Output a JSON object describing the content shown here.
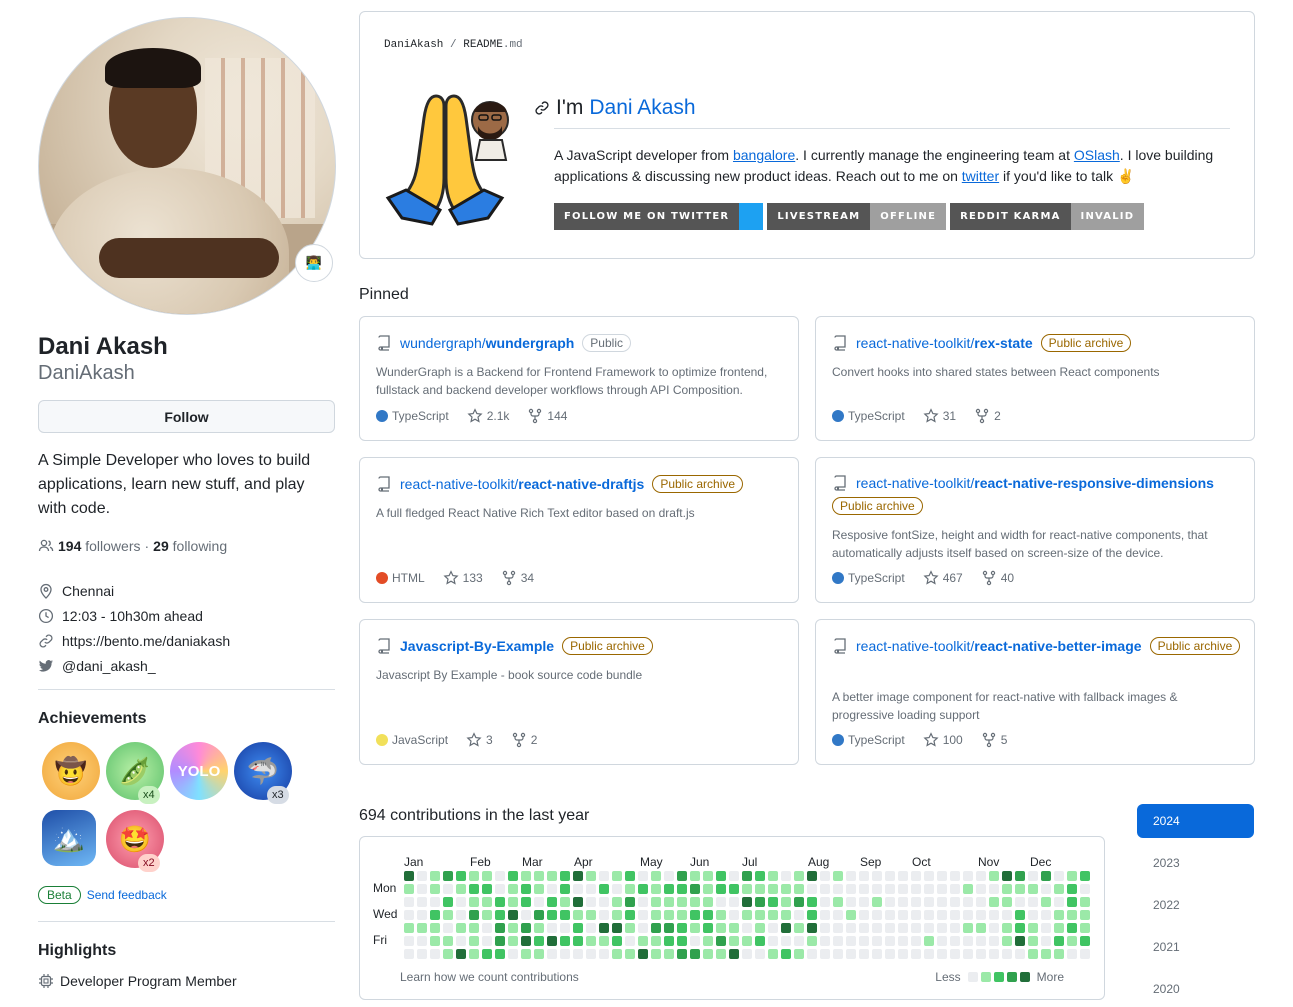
{
  "profile": {
    "name": "Dani Akash",
    "username": "DaniAkash",
    "status_emoji": "👨‍💻",
    "follow_label": "Follow",
    "bio": "A Simple Developer who loves to build applications, learn new stuff, and play with code.",
    "followers_count": "194",
    "followers_label": "followers",
    "dot": "·",
    "following_count": "29",
    "following_label": "following",
    "location": "Chennai",
    "local_time": "12:03 - 10h30m ahead",
    "website": "https://bento.me/daniakash",
    "twitter": "@dani_akash_"
  },
  "achievements": {
    "title": "Achievements",
    "badges": [
      {
        "name": "cowboy-badge",
        "emoji": "🤠",
        "count": ""
      },
      {
        "name": "pair-extraordinaire-badge",
        "emoji": "🫛",
        "count": "x4"
      },
      {
        "name": "yolo-badge",
        "emoji": "YOLO",
        "count": ""
      },
      {
        "name": "pull-shark-badge",
        "emoji": "🦈",
        "count": "x3"
      },
      {
        "name": "arctic-code-vault-badge",
        "emoji": "🏔️",
        "count": ""
      },
      {
        "name": "starstruck-badge",
        "emoji": "🤩",
        "count": "x2"
      }
    ],
    "beta_label": "Beta",
    "feedback_label": "Send feedback"
  },
  "highlights": {
    "title": "Highlights",
    "item": "Developer Program Member"
  },
  "readme": {
    "owner": "DaniAkash",
    "slash": "/",
    "file": "README",
    "ext": ".md",
    "heading_prefix": "I'm",
    "heading_name": "Dani Akash",
    "para_1": "A JavaScript developer from",
    "link_bangalore": "bangalore",
    "para_2": ". I currently manage the engineering team at",
    "link_oslash": "OSlash",
    "para_3": ". I love building applications & discussing new product ideas. Reach out to me on",
    "link_twitter": "twitter",
    "para_4": "if you'd like to talk ✌️",
    "shields": [
      {
        "label": "FOLLOW ME ON TWITTER",
        "value": "",
        "color": "#1DA1F2"
      },
      {
        "label": "LIVESTREAM",
        "value": "OFFLINE",
        "color": "#9f9f9f"
      },
      {
        "label": "REDDIT KARMA",
        "value": "INVALID",
        "color": "#9f9f9f"
      }
    ]
  },
  "pinned": {
    "title": "Pinned",
    "repos": [
      {
        "owner": "wundergraph/",
        "name": "wundergraph",
        "visibility": "Public",
        "archive": false,
        "description": "WunderGraph is a Backend for Frontend Framework to optimize frontend, fullstack and backend developer workflows through API Composition.",
        "language": "TypeScript",
        "lang_color": "#3178c6",
        "stars": "2.1k",
        "forks": "144"
      },
      {
        "owner": "react-native-toolkit/",
        "name": "rex-state",
        "visibility": "Public archive",
        "archive": true,
        "description": "Convert hooks into shared states between React components",
        "language": "TypeScript",
        "lang_color": "#3178c6",
        "stars": "31",
        "forks": "2"
      },
      {
        "owner": "react-native-toolkit/",
        "name": "react-native-draftjs",
        "visibility": "Public archive",
        "archive": true,
        "description": "A full fledged React Native Rich Text editor based on draft.js",
        "language": "HTML",
        "lang_color": "#e34c26",
        "stars": "133",
        "forks": "34"
      },
      {
        "owner": "react-native-toolkit/",
        "name": "react-native-responsive-dimensions",
        "visibility": "Public archive",
        "archive": true,
        "description": "Resposive fontSize, height and width for react-native components, that automatically adjusts itself based on screen-size of the device.",
        "language": "TypeScript",
        "lang_color": "#3178c6",
        "stars": "467",
        "forks": "40"
      },
      {
        "owner": "",
        "name": "Javascript-By-Example",
        "visibility": "Public archive",
        "archive": true,
        "description": "Javascript By Example - book source code bundle",
        "language": "JavaScript",
        "lang_color": "#f1e05a",
        "stars": "3",
        "forks": "2"
      },
      {
        "owner": "react-native-toolkit/",
        "name": "react-native-better-image",
        "visibility": "Public archive",
        "archive": true,
        "description": "A better image component for react-native with fallback images & progressive loading support",
        "language": "TypeScript",
        "lang_color": "#3178c6",
        "stars": "100",
        "forks": "5"
      }
    ]
  },
  "contributions": {
    "title": "694 contributions in the last year",
    "months": [
      "Jan",
      "Feb",
      "Mar",
      "Apr",
      "May",
      "Jun",
      "Jul",
      "Aug",
      "Sep",
      "Oct",
      "Nov",
      "Dec"
    ],
    "days": [
      "Mon",
      "Wed",
      "Fri"
    ],
    "learn_label": "Learn how we count contributions",
    "less_label": "Less",
    "more_label": "More",
    "colors": [
      "#ebedf0",
      "#9be9a8",
      "#40c463",
      "#30a14e",
      "#216e39"
    ]
  },
  "years": [
    "2024",
    "2023",
    "2022",
    "2021",
    "2020"
  ]
}
